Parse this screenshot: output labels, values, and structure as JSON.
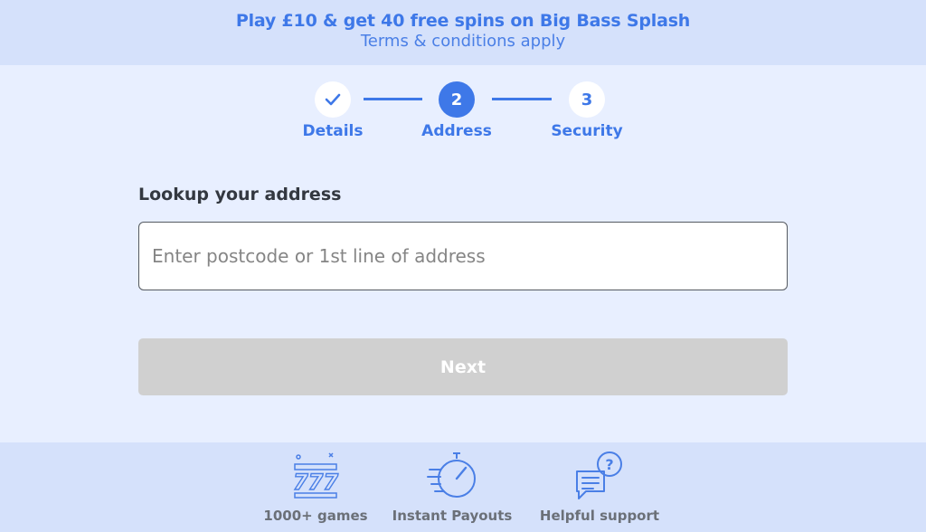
{
  "promo": {
    "title": "Play £10 & get 40 free spins on Big Bass Splash",
    "subtitle": "Terms & conditions apply"
  },
  "stepper": {
    "steps": [
      {
        "number": "✓",
        "label": "Details",
        "state": "done"
      },
      {
        "number": "2",
        "label": "Address",
        "state": "active"
      },
      {
        "number": "3",
        "label": "Security",
        "state": "todo"
      }
    ]
  },
  "lookup": {
    "label": "Lookup your address",
    "placeholder": "Enter postcode or 1st line of address",
    "value": ""
  },
  "next_button": {
    "label": "Next"
  },
  "features": [
    {
      "icon": "slot-777-icon",
      "label": "1000+ games"
    },
    {
      "icon": "stopwatch-icon",
      "label": "Instant Payouts"
    },
    {
      "icon": "chat-question-icon",
      "label": "Helpful support"
    }
  ],
  "colors": {
    "accent": "#3e78e8",
    "background": "#e8efff",
    "banner": "#d5e1fb",
    "disabled_button": "#d0d0d0"
  }
}
